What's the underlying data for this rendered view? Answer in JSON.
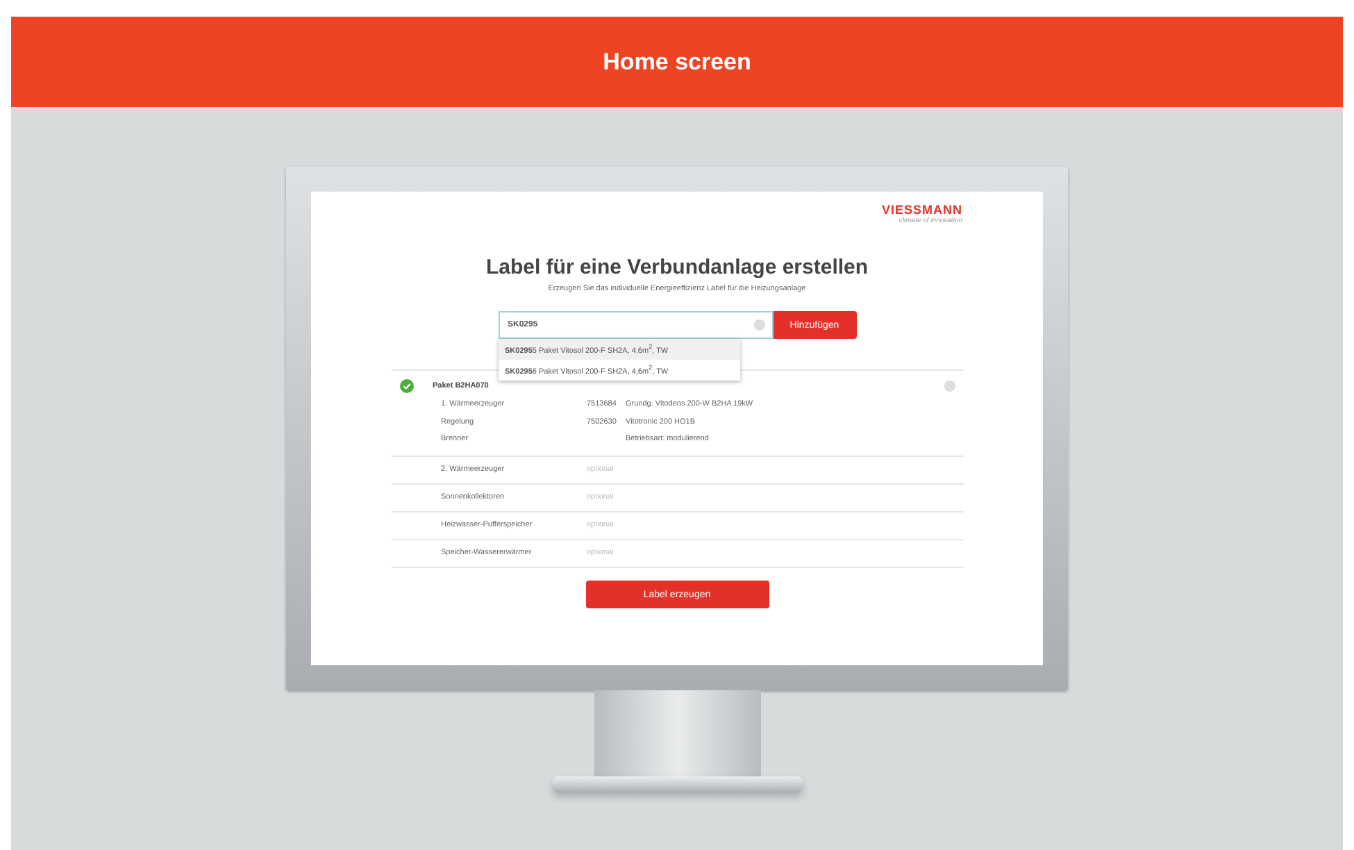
{
  "header": {
    "title": "Home screen"
  },
  "brand": {
    "logo": "VIESSMANN",
    "tagline": "climate of innovation"
  },
  "page": {
    "title": "Label für eine Verbundanlage erstellen",
    "subtitle": "Erzeugen Sie das individuelle Energieeffizienz Label für die Heizungsanlage"
  },
  "search": {
    "value": "SK0295",
    "add_button": "Hinzufügen"
  },
  "suggestions": [
    {
      "text": "**SK0295**5 Paket Vitosol 200-F SH2A, 4,6m$^{2}$, TW",
      "selected": true
    },
    {
      "text": "**SK0295**6 Paket Vitosol 200-F SH2A, 4,6m$^{2}$, TW",
      "selected": false
    }
  ],
  "package": {
    "name": "Paket B2HA070",
    "complete": true,
    "rows": [
      {
        "label": "1. Wärmeerzeuger",
        "number": "7513684",
        "description": "Grundg. Vitodens 200-W B2HA 19kW"
      },
      {
        "label": "Regelung",
        "number": "7502630",
        "description": "Vitotronic 200 HO1B"
      },
      {
        "label": "Brenner",
        "number": "",
        "description": "Betriebsart: modulierend"
      }
    ]
  },
  "optional_rows": [
    {
      "label": "2. Wärmeerzeuger",
      "value": "optional"
    },
    {
      "label": "Sonnenkollektoren",
      "value": "optional"
    },
    {
      "label": "Heizwasser-Pufferspeicher",
      "value": "optional"
    },
    {
      "label": "Speicher-Wassererwärmer",
      "value": "optional"
    }
  ],
  "submit_button": "Label erzeugen"
}
